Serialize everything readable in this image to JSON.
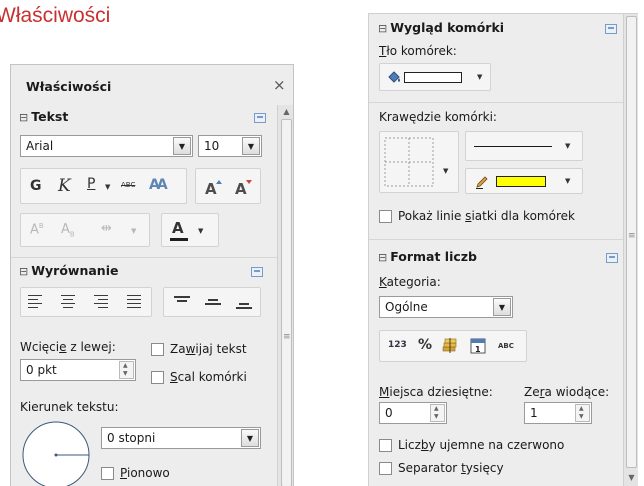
{
  "heading": "Właściwości",
  "sidebar": {
    "title": "Właściwości",
    "close_glyph": "×",
    "text_section": {
      "title": "Tekst",
      "font_name": "Arial",
      "font_size": "10",
      "bold_label": "G",
      "italic_label": "K",
      "underline_label": "P",
      "strike_label": "ABC",
      "shadow_label": "AA"
    },
    "align_section": {
      "title": "Wyrównanie",
      "indent_label_pre": "Wcięci",
      "indent_label_u": "e",
      "indent_label_post": " z lewej:",
      "indent_value": "0 pkt",
      "wrap_label_pre": "Za",
      "wrap_label_u": "w",
      "wrap_label_post": "ijaj tekst",
      "merge_label_u": "S",
      "merge_label_post": "cal komórki",
      "direction_label": "Kierunek tekstu:",
      "rotation_value": "0 stopni",
      "vertical_label_u": "P",
      "vertical_label_post": "ionowo"
    }
  },
  "cell_panel": {
    "appearance": {
      "title": "Wygląd komórki",
      "background_label_u": "T",
      "background_label_post": "ło komórek:",
      "borders_label": "Krawędzie komórki:",
      "line_color": "#ffff00",
      "grid_check_pre": "Pokaż linie ",
      "grid_check_u": "s",
      "grid_check_post": "iatki dla komórek"
    },
    "number_format": {
      "title": "Format liczb",
      "category_label_u": "K",
      "category_label_post": "ategoria:",
      "category_value": "Ogólne",
      "fmt_number": "123",
      "fmt_percent": "%",
      "fmt_abc": "ABC",
      "decimals_label_u": "M",
      "decimals_label_post": "iejsca dziesiętne:",
      "decimals_value": "0",
      "leading_label_pre": "Ze",
      "leading_label_u": "r",
      "leading_label_post": "a wiodące:",
      "leading_value": "1",
      "negative_pre": "Licz",
      "negative_u": "b",
      "negative_post": "y ujemne na czerwono",
      "thousands_pre": "Separator ",
      "thousands_u": "t",
      "thousands_post": "ysięcy"
    }
  }
}
